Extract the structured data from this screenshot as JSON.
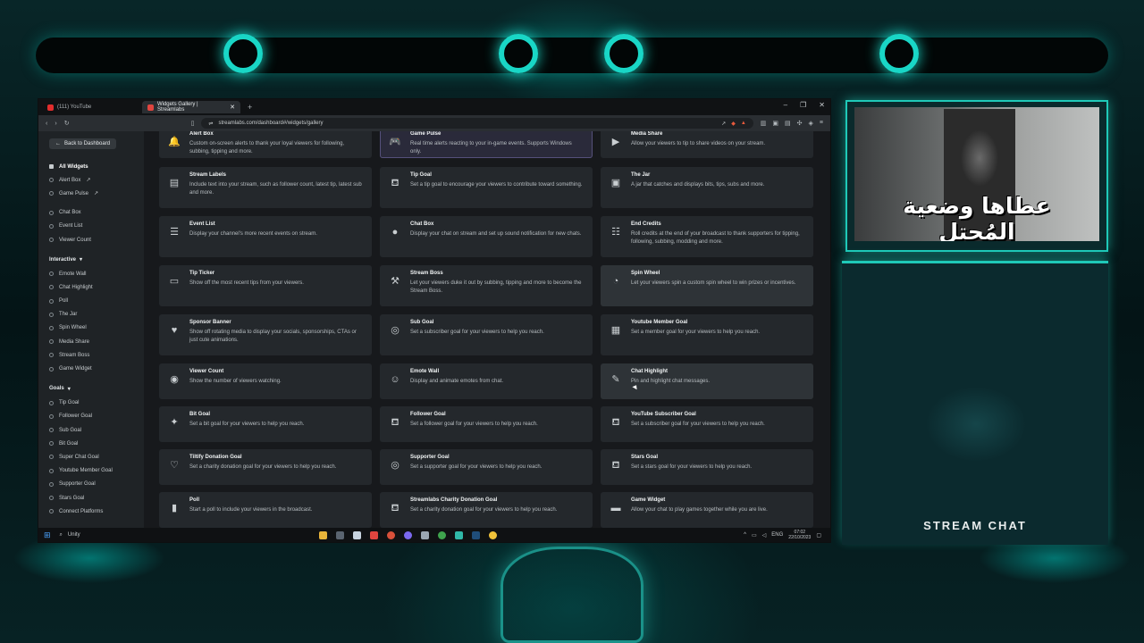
{
  "browser": {
    "tabs": [
      {
        "label": "(111) YouTube",
        "favicon_color": "#e22d2d",
        "active": false
      },
      {
        "label": "Widgets Gallery | Streamlabs",
        "favicon_color": "#e0453f",
        "active": true
      }
    ],
    "url": "streamlabs.com/dashboard#/widgets/gallery"
  },
  "sidebar": {
    "back_label": "Back to Dashboard",
    "top_items": [
      "All Widgets",
      "Alert Box",
      "Game Pulse"
    ],
    "items_a": [
      "Chat Box",
      "Event List",
      "Viewer Count"
    ],
    "section_interactive": "Interactive",
    "interactive_items": [
      "Emote Wall",
      "Chat Highlight",
      "Poll",
      "The Jar",
      "Spin Wheel",
      "Media Share",
      "Stream Boss",
      "Game Widget"
    ],
    "section_goals": "Goals",
    "goal_items": [
      "Tip Goal",
      "Follower Goal",
      "Sub Goal",
      "Bit Goal",
      "Super Chat Goal",
      "Youtube Member Goal",
      "Supporter Goal",
      "Stars Goal",
      "Connect Platforms"
    ]
  },
  "widgets": [
    {
      "title": "Alert Box",
      "desc": "Custom on-screen alerts to thank your loyal viewers for following, subbing, tipping and more.",
      "icon": "bell-icon",
      "glyph": "🔔"
    },
    {
      "title": "Game Pulse",
      "desc": "Real time alerts reacting to your in-game events. Supports Windows only.",
      "icon": "gamepad-icon",
      "glyph": "🎮"
    },
    {
      "title": "Media Share",
      "desc": "Allow your viewers to tip to share videos on your stream.",
      "icon": "play-icon",
      "glyph": "▶"
    },
    {
      "title": "Stream Labels",
      "desc": "Include text into your stream, such as follower count, latest tip, latest sub and more.",
      "icon": "file-icon",
      "glyph": "▤"
    },
    {
      "title": "Tip Goal",
      "desc": "Set a tip goal to encourage your viewers to contribute toward something.",
      "icon": "goal-icon",
      "glyph": "⛾"
    },
    {
      "title": "The Jar",
      "desc": "A jar that catches and displays bits, tips, subs and more.",
      "icon": "jar-icon",
      "glyph": "▣"
    },
    {
      "title": "Event List",
      "desc": "Display your channel's more recent events on stream.",
      "icon": "list-icon",
      "glyph": "☰"
    },
    {
      "title": "Chat Box",
      "desc": "Display your chat on stream and set up sound notification for new chats.",
      "icon": "chat-bubble-icon",
      "glyph": "●"
    },
    {
      "title": "End Credits",
      "desc": "Roll credits at the end of your broadcast to thank supporters for tipping, following, subbing, modding and more.",
      "icon": "credits-icon",
      "glyph": "☷"
    },
    {
      "title": "Tip Ticker",
      "desc": "Show off the most recent tips from your viewers.",
      "icon": "ticker-icon",
      "glyph": "▭"
    },
    {
      "title": "Stream Boss",
      "desc": "Let your viewers duke it out by subbing, tipping and more to become the Stream Boss.",
      "icon": "hammer-icon",
      "glyph": "⚒"
    },
    {
      "title": "Spin Wheel",
      "desc": "Let your viewers spin a custom spin wheel to win prizes or incentives.",
      "icon": "wheel-icon",
      "glyph": "◔"
    },
    {
      "title": "Sponsor Banner",
      "desc": "Show off rotating media to display your socials, sponsorships, CTAs or just cute animations.",
      "icon": "heart-icon",
      "glyph": "♥"
    },
    {
      "title": "Sub Goal",
      "desc": "Set a subscriber goal for your viewers to help you reach.",
      "icon": "target-icon",
      "glyph": "◎"
    },
    {
      "title": "Youtube Member Goal",
      "desc": "Set a member goal for your viewers to help you reach.",
      "icon": "member-icon",
      "glyph": "▦"
    },
    {
      "title": "Viewer Count",
      "desc": "Show the number of viewers watching.",
      "icon": "eye-icon",
      "glyph": "◉"
    },
    {
      "title": "Emote Wall",
      "desc": "Display and animate emotes from chat.",
      "icon": "smile-icon",
      "glyph": "☺"
    },
    {
      "title": "Chat Highlight",
      "desc": "Pin and highlight chat messages.",
      "icon": "pen-icon",
      "glyph": "✎"
    },
    {
      "title": "Bit Goal",
      "desc": "Set a bit goal for your viewers to help you reach.",
      "icon": "bits-icon",
      "glyph": "✦"
    },
    {
      "title": "Follower Goal",
      "desc": "Set a follower goal for your viewers to help you reach.",
      "icon": "follower-icon",
      "glyph": "⛾"
    },
    {
      "title": "YouTube Subscriber Goal",
      "desc": "Set a subscriber goal for your viewers to help you reach.",
      "icon": "subscriber-icon",
      "glyph": "⛾"
    },
    {
      "title": "Tiltify Donation Goal",
      "desc": "Set a charity donation goal for your viewers to help you reach.",
      "icon": "donation-icon",
      "glyph": "♡"
    },
    {
      "title": "Supporter Goal",
      "desc": "Set a supporter goal for your viewers to help you reach.",
      "icon": "supporter-icon",
      "glyph": "◎"
    },
    {
      "title": "Stars Goal",
      "desc": "Set a stars goal for your viewers to help you reach.",
      "icon": "stars-icon",
      "glyph": "⛾"
    },
    {
      "title": "Poll",
      "desc": "Start a poll to include your viewers in the broadcast.",
      "icon": "poll-icon",
      "glyph": "▮"
    },
    {
      "title": "Streamlabs Charity Donation Goal",
      "desc": "Set a charity donation goal for your viewers to help you reach.",
      "icon": "charity-icon",
      "glyph": "⛾"
    },
    {
      "title": "Game Widget",
      "desc": "Allow your chat to play games together while you are live.",
      "icon": "controller-icon",
      "glyph": "▬"
    }
  ],
  "taskbar": {
    "search_placeholder": "Unity",
    "lang": "ENG",
    "time": "07:02",
    "date": "22/10/2023"
  },
  "overlay": {
    "webcam_caption": "عطاها وضعية المُحتل",
    "chat_title": "STREAM CHAT",
    "accent": "#1fc9b8"
  }
}
